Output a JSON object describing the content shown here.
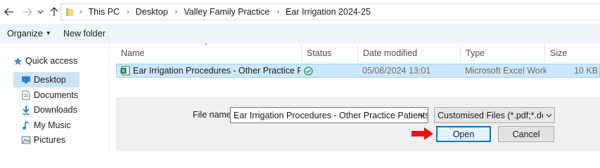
{
  "address_bar": {
    "breadcrumbs": [
      "This PC",
      "Desktop",
      "Valley Family Practice",
      "Ear Irrigation 2024-25"
    ]
  },
  "toolbar": {
    "organize_label": "Organize",
    "new_folder_label": "New folder"
  },
  "sidebar": {
    "items": [
      {
        "label": "Quick access",
        "icon": "star-icon"
      },
      {
        "label": "Desktop",
        "icon": "desktop-icon",
        "selected": true
      },
      {
        "label": "Documents",
        "icon": "documents-icon"
      },
      {
        "label": "Downloads",
        "icon": "downloads-icon"
      },
      {
        "label": "My Music",
        "icon": "music-icon"
      },
      {
        "label": "Pictures",
        "icon": "pictures-icon"
      }
    ]
  },
  "columns": [
    "Name",
    "Status",
    "Date modified",
    "Type",
    "Size"
  ],
  "files": [
    {
      "name": "Ear Irrigation Procedures - Other Practice Patien...",
      "status_icon": "synced-check-icon",
      "date_modified": "05/08/2024 13:01",
      "type": "Microsoft Excel Work...",
      "size": "10 KB",
      "file_icon": "excel-file-icon"
    }
  ],
  "file_name": {
    "label": "File name:",
    "value": "Ear Irrigation Procedures - Other Practice Patients.xlsx"
  },
  "file_type": {
    "value": "Customised Files (*.pdf;*.docx;*"
  },
  "buttons": {
    "open": "Open",
    "cancel": "Cancel"
  },
  "colors": {
    "selection_bg": "#cce8ff",
    "selection_border": "#99d1ff",
    "primary_border": "#0078d7",
    "annotation_arrow": "#e8150d",
    "excel_green": "#1d6f42",
    "status_green": "#2e8b3a"
  }
}
